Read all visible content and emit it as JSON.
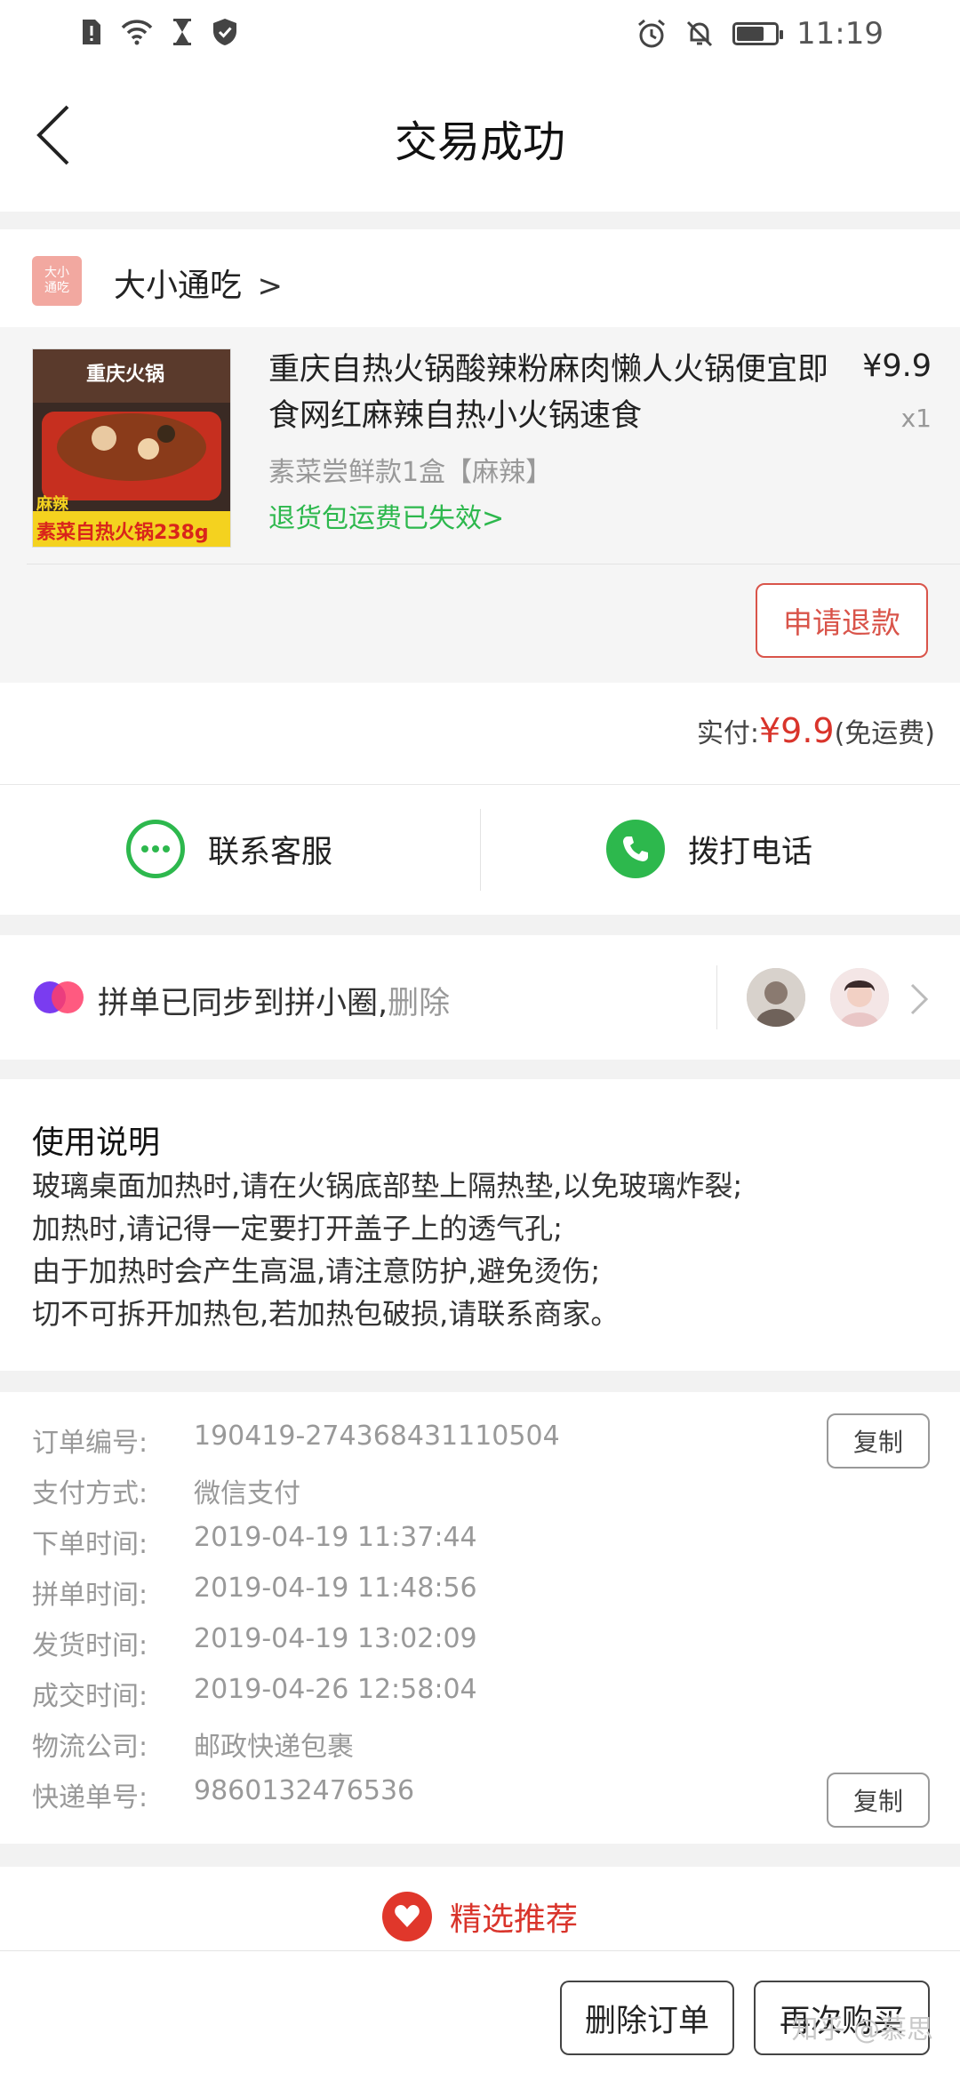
{
  "status_bar": {
    "time": "11:19",
    "left_icons": [
      "sim-alert-icon",
      "wifi-icon",
      "hourglass-icon",
      "shield-check-icon"
    ],
    "right_icons": [
      "alarm-icon",
      "mute-icon",
      "battery-icon"
    ],
    "battery_level": 0.65
  },
  "header": {
    "title": "交易成功",
    "back_icon": "back-chevron-icon"
  },
  "shop": {
    "logo_text": "大小\n通吃",
    "name": "大小通吃",
    "chevron": ">"
  },
  "product": {
    "title": "重庆自热火锅酸辣粉麻肉懒人火锅便宜即食网红麻辣自热小火锅速食",
    "price": "¥9.9",
    "quantity": "x1",
    "sku": "素菜尝鲜款1盒【麻辣】",
    "note": "退货包运费已失效",
    "note_chevron": ">",
    "thumb_labels": {
      "top": "重庆火锅",
      "flavor": "麻辣",
      "bottom": "素菜自热火锅238g"
    },
    "refund_button": "申请退款"
  },
  "payment": {
    "label": "实付:",
    "amount": "¥9.9",
    "note": "(免运费)"
  },
  "contact": {
    "service_label": "联系客服",
    "service_icon": "chat-bubble-icon",
    "call_label": "拨打电话",
    "call_icon": "phone-icon"
  },
  "group": {
    "text": "拼单已同步到拼小圈,",
    "delete_label": "删除",
    "chevron": ">"
  },
  "instructions": {
    "title": "使用说明",
    "lines": [
      "玻璃桌面加热时,请在火锅底部垫上隔热垫,以免玻璃炸裂;",
      "加热时,请记得一定要打开盖子上的透气孔;",
      "由于加热时会产生高温,请注意防护,避免烫伤;",
      "切不可拆开加热包,若加热包破损,请联系商家。"
    ]
  },
  "order_info": {
    "rows": [
      {
        "label": "订单编号:",
        "value": "190419-274368431110504"
      },
      {
        "label": "支付方式:",
        "value": "微信支付"
      },
      {
        "label": "下单时间:",
        "value": "2019-04-19 11:37:44"
      },
      {
        "label": "拼单时间:",
        "value": "2019-04-19 11:48:56"
      },
      {
        "label": "发货时间:",
        "value": "2019-04-19 13:02:09"
      },
      {
        "label": "成交时间:",
        "value": "2019-04-26 12:58:04"
      },
      {
        "label": "物流公司:",
        "value": "邮政快递包裹"
      },
      {
        "label": "快递单号:",
        "value": "9860132476536"
      }
    ],
    "copy_label": "复制"
  },
  "recommend": {
    "label": "精选推荐"
  },
  "bottom": {
    "delete_order": "删除订单",
    "buy_again": "再次购买",
    "watermark": "知乎 @慕思"
  },
  "colors": {
    "accent_red": "#d9342b",
    "green": "#2db84d",
    "muted": "#999999"
  }
}
